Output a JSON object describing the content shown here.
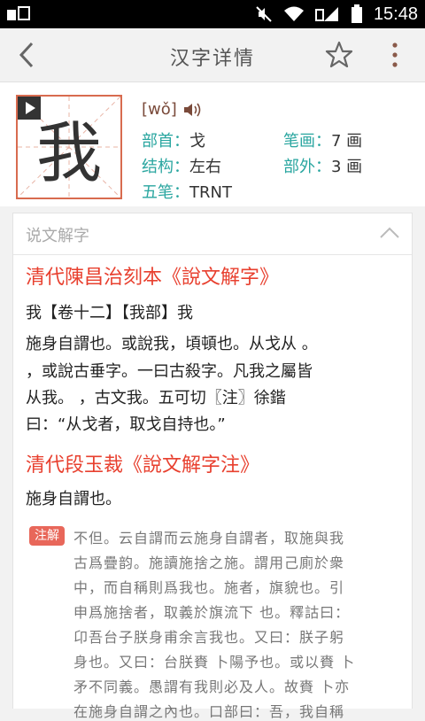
{
  "status_bar": {
    "time": "15:48"
  },
  "header": {
    "title": "汉字详情"
  },
  "char": {
    "glyph": "我",
    "pinyin": "[wǒ]",
    "radical_label": "部首：",
    "radical": "戈",
    "strokes_label": "笔画：",
    "strokes": "7 画",
    "structure_label": "结构：",
    "structure": "左右",
    "extra_label": "部外：",
    "extra": "3 画",
    "wubi_label": "五笔：",
    "wubi": "TRNT"
  },
  "section": {
    "title": "说文解字",
    "source1_title": "清代陳昌治刻本《說文解字》",
    "source1_lines": [
      "我【卷十二】【我部】我",
      "施身自謂也。或說我，頃頓也。从戈从 。",
      "，或說古垂字。一曰古殺字。凡我之屬皆",
      "从我。  ，古文我。五可切〖注〗徐鍇",
      "曰：“从戈者，取戈自持也。”"
    ],
    "source2_title": "清代段玉裁《說文解字注》",
    "source2_line": "施身自謂也。",
    "note_badge": "注解",
    "note_lines": [
      "不但。云自謂而云施身自謂者，取施與我",
      "古爲疊韵。施讀施捨之施。謂用己廁於衆",
      "中，而自稱則爲我也。施者，旗貌也。引",
      "申爲施捨者，取義於旗流下 也。釋詁曰：",
      "卬吾台子朕身甫余言我也。又曰：朕子躬",
      "身也。又曰：台朕賚 卜陽予也。或以賚 卜",
      "矛不同義。愚謂有我則必及人。故賚 卜亦",
      "在施身自謂之內也。口部曰：吾，我自稱"
    ]
  }
}
